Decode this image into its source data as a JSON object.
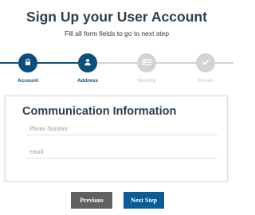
{
  "header": {
    "title": "Sign Up your User Account",
    "subtitle": "Fill all form fields to go to next step"
  },
  "progress": {
    "steps": [
      {
        "label": "Account",
        "icon": "lock-icon",
        "state": "completed"
      },
      {
        "label": "Address",
        "icon": "user-icon",
        "state": "active"
      },
      {
        "label": "Identity",
        "icon": "id-card-icon",
        "state": "pending"
      },
      {
        "label": "Finish",
        "icon": "check-icon",
        "state": "pending"
      }
    ],
    "active_color": "#0b4f7f",
    "inactive_color": "#d3d3d3"
  },
  "form": {
    "title": "Communication Information",
    "phone_placeholder": "Phone Number",
    "phone_value": "",
    "email_placeholder": "email",
    "email_value": ""
  },
  "buttons": {
    "previous_label": "Previous",
    "previous_color": "#616161",
    "next_label": "Next Step",
    "next_color": "#0b5c99"
  }
}
